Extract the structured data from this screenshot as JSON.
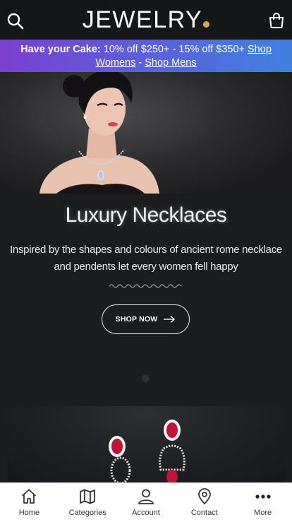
{
  "header": {
    "brand": "JEWELRY",
    "search_icon": "search-icon",
    "bag_icon": "shopping-bag-icon",
    "brand_dot_color": "#d7a55a"
  },
  "promo": {
    "lead": "Have your Cake:",
    "offer": " 10% off $250+ - 15% off $350+ ",
    "link_women": "Shop Womens",
    "separator": " - ",
    "link_men": "Shop Mens"
  },
  "slide": {
    "title": "Luxury Necklaces",
    "description": "Inspired by the shapes and colours of ancient rome necklace and pendents let every women fell happy",
    "button_label": "SHOP NOW"
  },
  "tabs": [
    {
      "label": "Home",
      "icon": "home-icon"
    },
    {
      "label": "Categories",
      "icon": "map-icon"
    },
    {
      "label": "Account",
      "icon": "user-icon"
    },
    {
      "label": "Contact",
      "icon": "location-pin-icon"
    },
    {
      "label": "More",
      "icon": "more-dots-icon"
    }
  ]
}
